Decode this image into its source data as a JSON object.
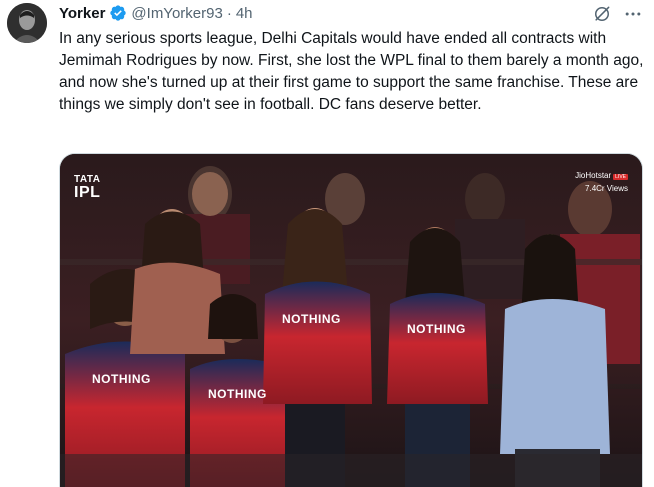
{
  "author": {
    "name": "Yorker",
    "handle": "@ImYorker93",
    "separator": "·",
    "time": "4h"
  },
  "icons": {
    "verified": "verified-badge-icon",
    "grok": "grok-icon",
    "more": "more-icon"
  },
  "tweet": {
    "text": "In any serious sports league, Delhi Capitals would have ended all contracts with Jemimah Rodrigues by now. First, she lost the WPL final to them barely a month ago, and now she's turned up at their first game to support the same franchise. These are things we simply don't see in football. DC fans deserve better."
  },
  "media": {
    "logo_tata": "TATA",
    "logo_ipl": "IPL",
    "broadcaster": "JioHotstar",
    "live": "LIVE",
    "views": "7.4Cr Views",
    "jersey_sponsor": "NOTHING"
  },
  "colors": {
    "verified_blue": "#1d9bf0",
    "secondary_text": "#536471",
    "jersey_red": "#c8262f",
    "jersey_navy": "#1b2b5a"
  }
}
